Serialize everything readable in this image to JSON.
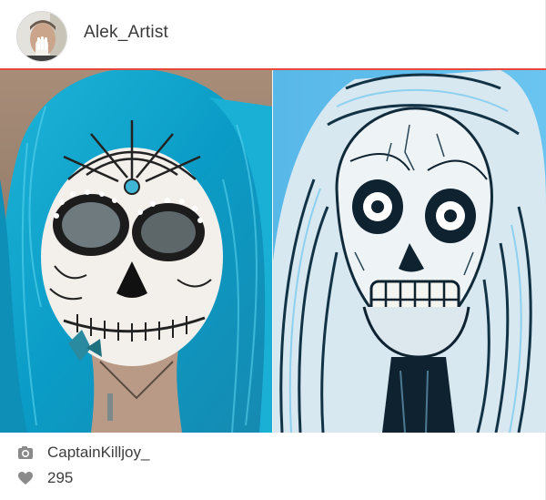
{
  "post": {
    "author": {
      "username": "Alek_Artist",
      "avatar_icon": "user-avatar"
    },
    "accent_color": "#e8473b",
    "photo_left": {
      "subject": "sugar-skull-makeup-photo"
    },
    "photo_right": {
      "subject": "skull-drawing"
    },
    "credit": {
      "icon": "camera-icon",
      "name": "CaptainKilljoy_"
    },
    "likes": {
      "icon": "heart-icon",
      "count": "295"
    }
  }
}
